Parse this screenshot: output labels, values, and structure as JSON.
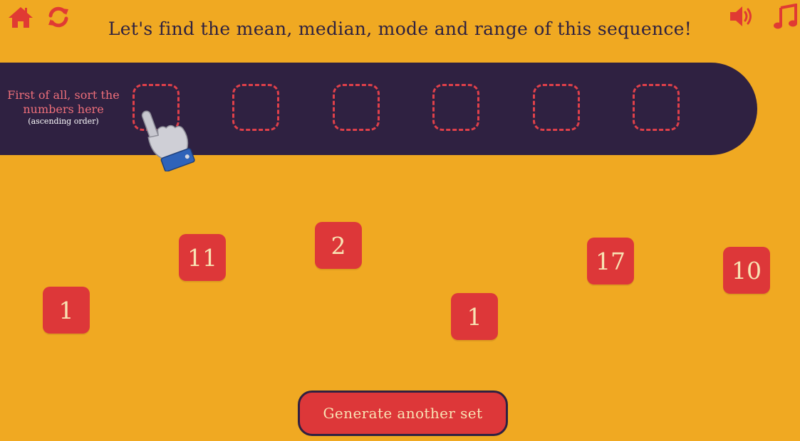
{
  "header": {
    "title": "Let's find the mean, median, mode and range of this sequence!",
    "icons": [
      "home-icon",
      "refresh-icon",
      "volume-icon",
      "music-icon"
    ]
  },
  "sort_area": {
    "instruction": "First of all, sort the numbers here",
    "instruction_sub": "(ascending order)",
    "slot_count": 6
  },
  "tiles": [
    "1",
    "11",
    "2",
    "1",
    "17",
    "10"
  ],
  "generate_button": "Generate another set",
  "colors": {
    "background": "#f0a922",
    "band": "#2f2141",
    "tile": "#dd3739",
    "tile_text": "#f8e3b4",
    "slot_border": "#e0404a",
    "instruction_text": "#ee6f7a"
  },
  "pointer": "hand-pointer-icon"
}
